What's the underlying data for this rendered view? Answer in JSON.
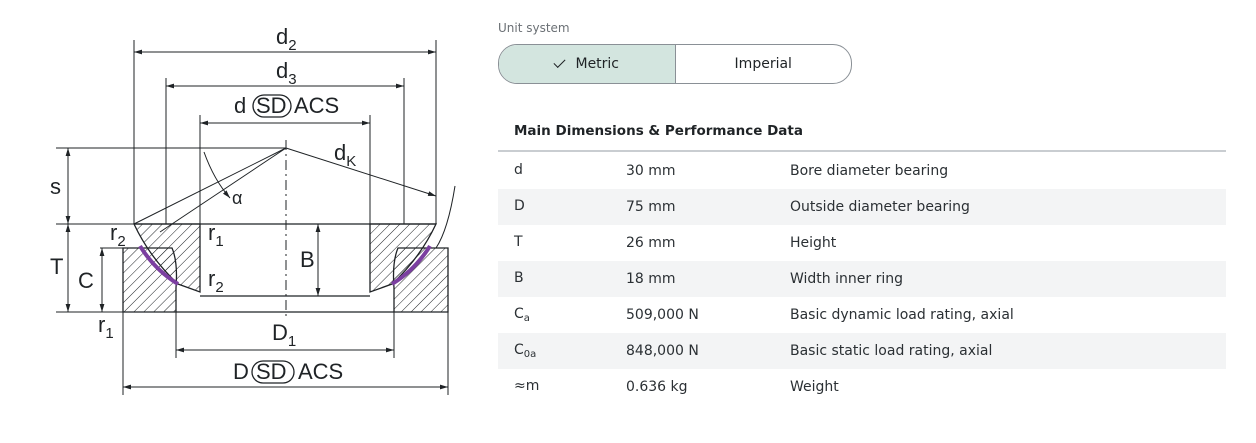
{
  "drawing": {
    "labels": {
      "d2": "d",
      "d2_sub": "2",
      "d3": "d",
      "d3_sub": "3",
      "d_sd_pre": "d",
      "sd": "SD",
      "acs": "ACS",
      "dk": "d",
      "dk_sub": "K",
      "s": "s",
      "alpha": "α",
      "r2_top": "r",
      "r2_top_sub": "2",
      "r1_inner": "r",
      "r1_inner_sub": "1",
      "r2_inner": "r",
      "r2_inner_sub": "2",
      "B": "B",
      "T": "T",
      "C": "C",
      "r1_bottom": "r",
      "r1_bottom_sub": "1",
      "D1": "D",
      "D1_sub": "1",
      "D_sd_pre": "D",
      "D_sd": "SD",
      "D_acs": "ACS"
    }
  },
  "unit_system": {
    "label": "Unit system",
    "options": [
      "Metric",
      "Imperial"
    ],
    "selected": "Metric"
  },
  "table": {
    "title": "Main Dimensions & Performance Data",
    "rows": [
      {
        "symbol": "d",
        "sub": "",
        "value": "30 mm",
        "description": "Bore diameter bearing"
      },
      {
        "symbol": "D",
        "sub": "",
        "value": "75 mm",
        "description": "Outside diameter bearing"
      },
      {
        "symbol": "T",
        "sub": "",
        "value": "26 mm",
        "description": "Height"
      },
      {
        "symbol": "B",
        "sub": "",
        "value": "18 mm",
        "description": "Width inner ring"
      },
      {
        "symbol": "C",
        "sub": "a",
        "value": "509,000 N",
        "description": "Basic dynamic load rating, axial"
      },
      {
        "symbol": "C",
        "sub": "0a",
        "value": "848,000 N",
        "description": "Basic static load rating, axial"
      },
      {
        "symbol": "≈m",
        "sub": "",
        "value": "0.636 kg",
        "description": "Weight"
      }
    ]
  }
}
